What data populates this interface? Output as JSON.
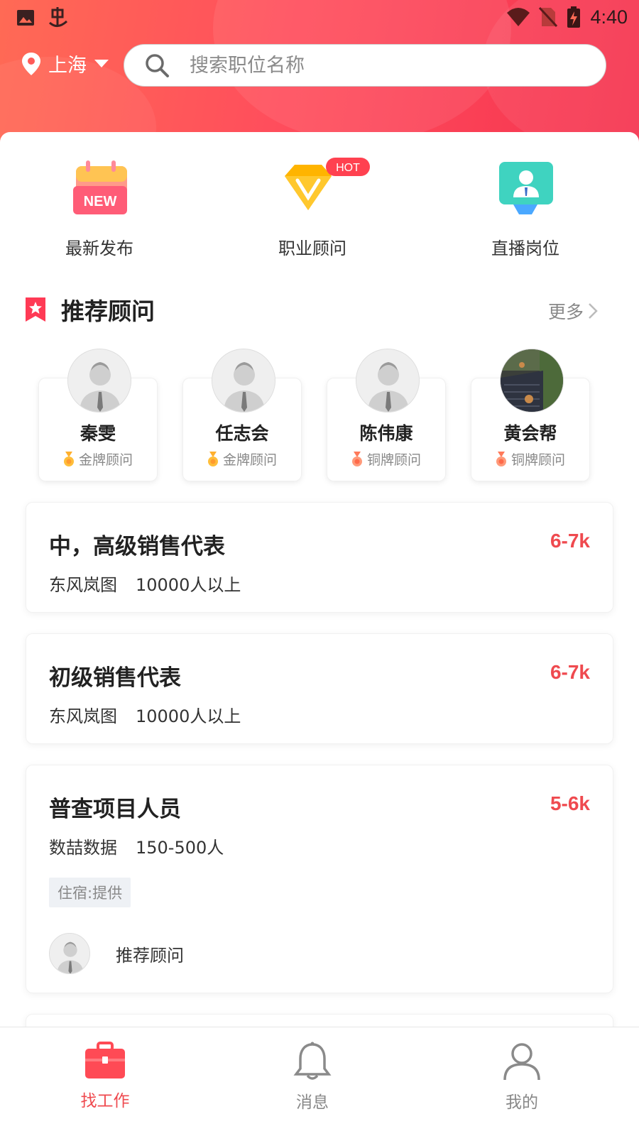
{
  "status_bar": {
    "time": "4:40"
  },
  "header": {
    "location": "上海",
    "search_placeholder": "搜索职位名称"
  },
  "quick_actions": [
    {
      "label": "最新发布",
      "icon": "new-calendar-icon",
      "badge": "NEW"
    },
    {
      "label": "职业顾问",
      "icon": "diamond-v-icon",
      "badge": "HOT"
    },
    {
      "label": "直播岗位",
      "icon": "live-presenter-icon"
    }
  ],
  "recommended": {
    "title": "推荐顾问",
    "more": "更多",
    "consultants": [
      {
        "name": "秦雯",
        "rank": "金牌顾问"
      },
      {
        "name": "任志会",
        "rank": "金牌顾问"
      },
      {
        "name": "陈伟康",
        "rank": "铜牌顾问"
      },
      {
        "name": "黄会帮",
        "rank": "铜牌顾问"
      }
    ]
  },
  "jobs": [
    {
      "title": "中，高级销售代表",
      "salary": "6-7k",
      "company": "东风岚图",
      "size": "10000人以上"
    },
    {
      "title": "初级销售代表",
      "salary": "6-7k",
      "company": "东风岚图",
      "size": "10000人以上"
    },
    {
      "title": "普查项目人员",
      "salary": "5-6k",
      "company": "数喆数据",
      "size": "150-500人",
      "tag": "住宿:提供",
      "recommender": "推荐顾问"
    }
  ],
  "bottom_nav": [
    {
      "label": "找工作",
      "active": true
    },
    {
      "label": "消息"
    },
    {
      "label": "我的"
    }
  ],
  "colors": {
    "accent": "#ef4a4f",
    "header_start": "#ff6a55",
    "header_end": "#f5334f"
  }
}
